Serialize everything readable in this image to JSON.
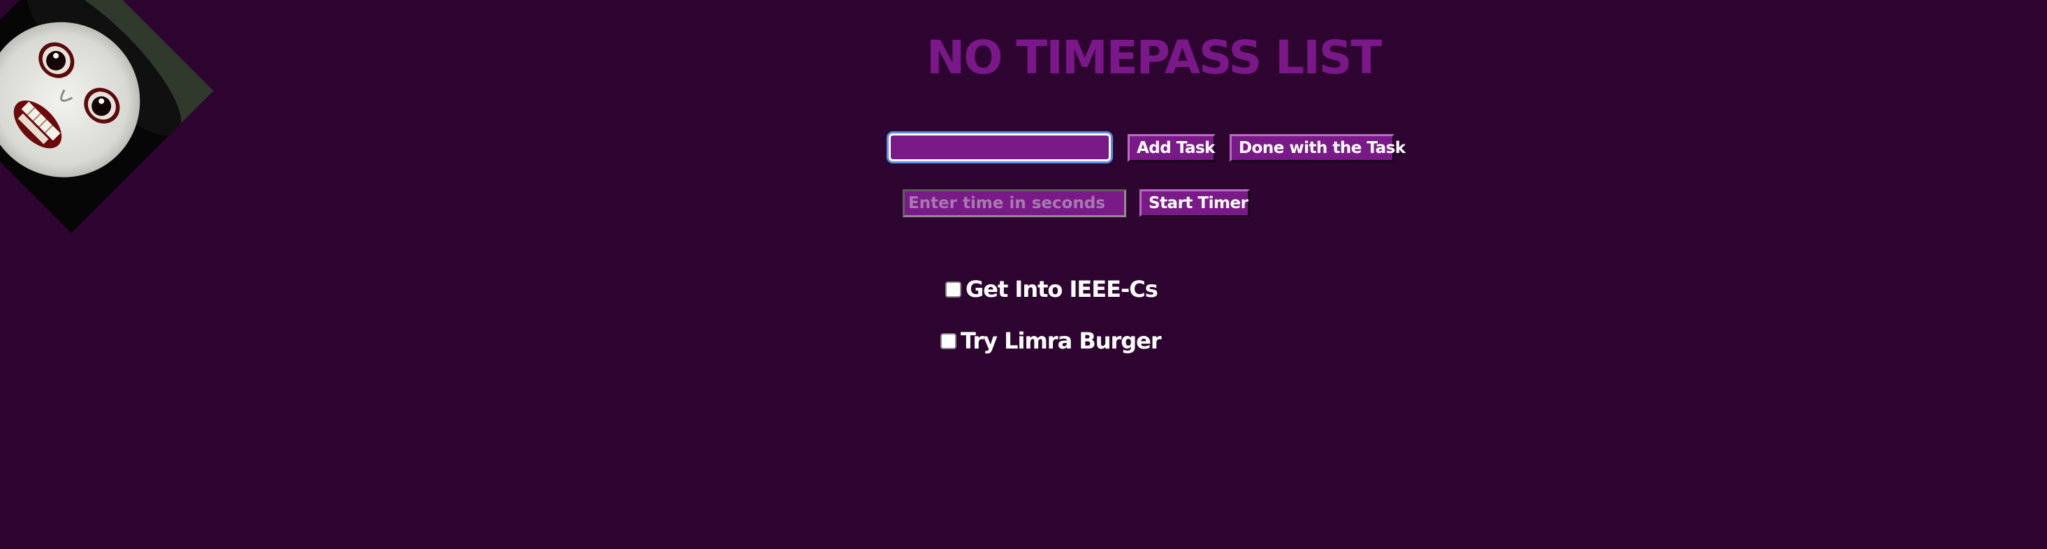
{
  "app": {
    "title": "NO TIMEPASS LIST"
  },
  "decor": {
    "image_icon": "scary-mask-face-image"
  },
  "colors": {
    "background": "#2e0530",
    "accent": "#7a1a88",
    "title": "#7a1889",
    "text": "#ffffff",
    "focus_ring": "#5a8fe8"
  },
  "task_form": {
    "input_value": "",
    "input_placeholder": "",
    "add_label": "Add Task",
    "done_label": "Done with the Task"
  },
  "timer_form": {
    "input_value": "",
    "input_placeholder": "Enter time in seconds",
    "start_label": "Start Timer"
  },
  "tasks": [
    {
      "label": "Get Into IEEE-Cs",
      "checked": false
    },
    {
      "label": "Try Limra Burger",
      "checked": false
    }
  ]
}
